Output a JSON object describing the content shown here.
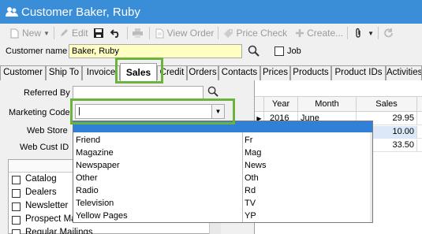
{
  "window": {
    "title": "Customer Baker, Ruby"
  },
  "toolbar": {
    "new": "New",
    "edit": "Edit",
    "view_order": "View Order",
    "price_check": "Price Check",
    "create": "Create..."
  },
  "customer": {
    "name_label": "Customer name",
    "name_value": "Baker, Ruby",
    "job_label": "Job"
  },
  "tabs": [
    "Customer",
    "Ship To",
    "Invoice",
    "Sales",
    "Credit",
    "Orders",
    "Contacts",
    "Prices",
    "Products",
    "Product IDs",
    "Activities"
  ],
  "active_tab": "Sales",
  "form": {
    "referred_by_label": "Referred By",
    "marketing_code_label": "Marketing Code",
    "marketing_code_value": "|",
    "web_store_label": "Web Store",
    "web_cust_id_label": "Web Cust ID"
  },
  "checklist": [
    "Catalog",
    "Dealers",
    "Newsletter",
    "Prospect Ma",
    "Regular Mailings"
  ],
  "grid": {
    "headers": [
      "Year",
      "Month",
      "Sales"
    ],
    "rows": [
      {
        "year": "2016",
        "month": "June",
        "sales": "29.95"
      },
      {
        "year": "",
        "month": "",
        "sales": "10.00"
      },
      {
        "year": "",
        "month": "",
        "sales": "33.50"
      }
    ]
  },
  "dropdown": {
    "items": [
      {
        "name": "Friend",
        "code": "Fr"
      },
      {
        "name": "Magazine",
        "code": "Mag"
      },
      {
        "name": "Newspaper",
        "code": "News"
      },
      {
        "name": "Other",
        "code": "Oth"
      },
      {
        "name": "Radio",
        "code": "Rd"
      },
      {
        "name": "Television",
        "code": "TV"
      },
      {
        "name": "Yellow Pages",
        "code": "YP"
      }
    ]
  },
  "colors": {
    "titlebar": "#3a8ed8",
    "highlight": "#6cb33e",
    "selection": "#2f80d6",
    "name_field": "#ffffc4"
  }
}
